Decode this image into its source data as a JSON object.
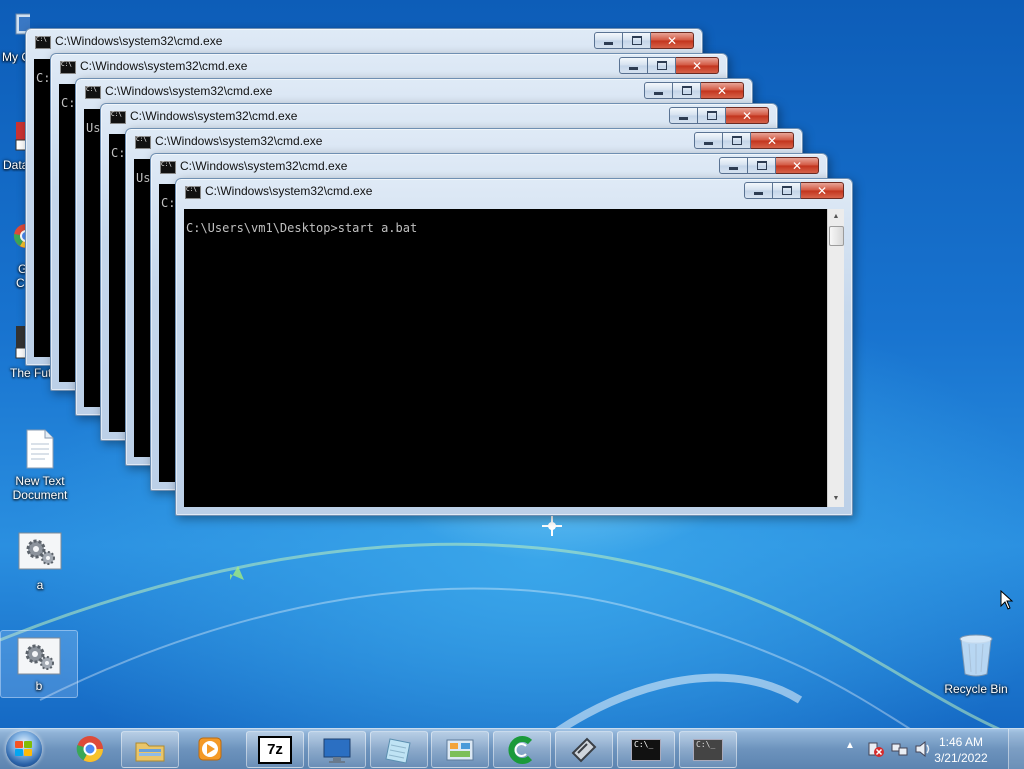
{
  "desktop": {
    "icons": [
      {
        "label": "My C",
        "name": "my-computer-icon"
      },
      {
        "label": "Data",
        "name": "data-icon"
      },
      {
        "label": "G",
        "name": "google-chrome-icon"
      },
      {
        "label": "C",
        "name": "google-chrome-icon-line2"
      },
      {
        "label": "The Fut",
        "name": "the-future-icon"
      },
      {
        "label": "New Text Document",
        "name": "new-text-document-icon"
      },
      {
        "label": "a",
        "name": "batch-file-a-icon"
      },
      {
        "label": "b",
        "name": "batch-file-b-icon"
      },
      {
        "label": "Recycle Bin",
        "name": "recycle-bin-icon"
      }
    ]
  },
  "cmd": {
    "title": "C:\\Windows\\system32\\cmd.exe",
    "partial_lines": [
      "C:",
      "C:",
      "Us",
      "C:",
      "Us",
      "C:",
      "C:"
    ],
    "active_prompt": "C:\\Users\\vm1\\Desktop>start a.bat",
    "close_glyph": "✕"
  },
  "taskbar": {
    "clock_time": "1:46 AM",
    "clock_date": "3/21/2022",
    "items": [
      {
        "name": "chrome-taskbar-icon"
      },
      {
        "name": "explorer-taskbar-icon"
      },
      {
        "name": "media-player-taskbar-icon"
      },
      {
        "name": "7zip-taskbar-icon",
        "label": "7z"
      },
      {
        "name": "remote-desktop-taskbar-icon"
      },
      {
        "name": "notepad-taskbar-icon"
      },
      {
        "name": "control-panel-taskbar-icon"
      },
      {
        "name": "ccleaner-taskbar-icon"
      },
      {
        "name": "tools-taskbar-icon"
      },
      {
        "name": "cmd-taskbar-icon"
      },
      {
        "name": "cmd-taskbar-icon-2"
      }
    ]
  }
}
